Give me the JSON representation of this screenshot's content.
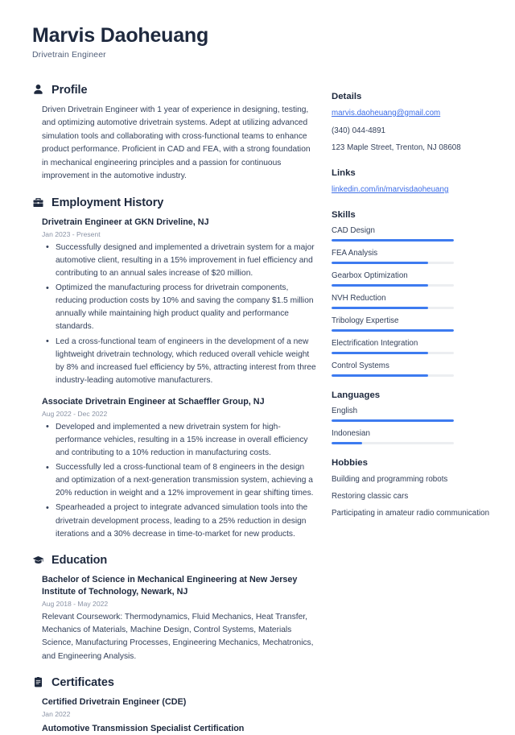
{
  "header": {
    "name": "Marvis Daoheuang",
    "role": "Drivetrain Engineer"
  },
  "sections": {
    "profile": {
      "title": "Profile",
      "icon": "user-icon",
      "text": "Driven Drivetrain Engineer with 1 year of experience in designing, testing, and optimizing automotive drivetrain systems. Adept at utilizing advanced simulation tools and collaborating with cross-functional teams to enhance product performance. Proficient in CAD and FEA, with a strong foundation in mechanical engineering principles and a passion for continuous improvement in the automotive industry."
    },
    "employment": {
      "title": "Employment History",
      "icon": "briefcase-icon",
      "entries": [
        {
          "title": "Drivetrain Engineer at GKN Driveline, NJ",
          "date": "Jan 2023 - Present",
          "bullets": [
            "Successfully designed and implemented a drivetrain system for a major automotive client, resulting in a 15% improvement in fuel efficiency and contributing to an annual sales increase of $20 million.",
            "Optimized the manufacturing process for drivetrain components, reducing production costs by 10% and saving the company $1.5 million annually while maintaining high product quality and performance standards.",
            "Led a cross-functional team of engineers in the development of a new lightweight drivetrain technology, which reduced overall vehicle weight by 8% and increased fuel efficiency by 5%, attracting interest from three industry-leading automotive manufacturers."
          ]
        },
        {
          "title": "Associate Drivetrain Engineer at Schaeffler Group, NJ",
          "date": "Aug 2022 - Dec 2022",
          "bullets": [
            "Developed and implemented a new drivetrain system for high-performance vehicles, resulting in a 15% increase in overall efficiency and contributing to a 10% reduction in manufacturing costs.",
            "Successfully led a cross-functional team of 8 engineers in the design and optimization of a next-generation transmission system, achieving a 20% reduction in weight and a 12% improvement in gear shifting times.",
            "Spearheaded a project to integrate advanced simulation tools into the drivetrain development process, leading to a 25% reduction in design iterations and a 30% decrease in time-to-market for new products."
          ]
        }
      ]
    },
    "education": {
      "title": "Education",
      "icon": "graduation-cap-icon",
      "entries": [
        {
          "title": "Bachelor of Science in Mechanical Engineering at New Jersey Institute of Technology, Newark, NJ",
          "date": "Aug 2018 - May 2022",
          "description": "Relevant Coursework: Thermodynamics, Fluid Mechanics, Heat Transfer, Mechanics of Materials, Machine Design, Control Systems, Materials Science, Manufacturing Processes, Engineering Mechanics, Mechatronics, and Engineering Analysis."
        }
      ]
    },
    "certificates": {
      "title": "Certificates",
      "icon": "clipboard-icon",
      "entries": [
        {
          "title": "Certified Drivetrain Engineer (CDE)",
          "date": "Jan 2022"
        },
        {
          "title": "Automotive Transmission Specialist Certification",
          "date": ""
        }
      ]
    }
  },
  "sidebar": {
    "details": {
      "title": "Details",
      "email": "marvis.daoheuang@gmail.com",
      "phone": "(340) 044-4891",
      "address": "123 Maple Street, Trenton, NJ 08608"
    },
    "links": {
      "title": "Links",
      "items": [
        {
          "label": "linkedin.com/in/marvisdaoheuang"
        }
      ]
    },
    "skills": {
      "title": "Skills",
      "items": [
        {
          "label": "CAD Design",
          "level": 100
        },
        {
          "label": "FEA Analysis",
          "level": 79
        },
        {
          "label": "Gearbox Optimization",
          "level": 79
        },
        {
          "label": "NVH Reduction",
          "level": 79
        },
        {
          "label": "Tribology Expertise",
          "level": 100
        },
        {
          "label": "Electrification Integration",
          "level": 79
        },
        {
          "label": "Control Systems",
          "level": 79
        }
      ]
    },
    "languages": {
      "title": "Languages",
      "items": [
        {
          "label": "English",
          "level": 100
        },
        {
          "label": "Indonesian",
          "level": 25
        }
      ]
    },
    "hobbies": {
      "title": "Hobbies",
      "items": [
        "Building and programming robots",
        "Restoring classic cars",
        "Participating in amateur radio communication"
      ]
    }
  },
  "colors": {
    "accent": "#3d7bf0",
    "link": "#3d6ee8",
    "heading": "#1e293e",
    "body": "#33405a",
    "muted": "#8a93a5",
    "track": "#eceef1"
  }
}
